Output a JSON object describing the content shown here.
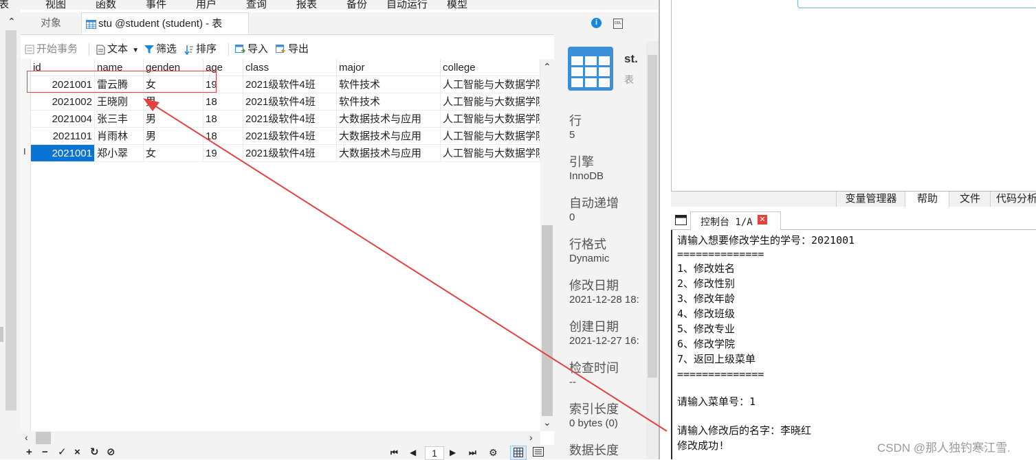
{
  "menu": {
    "items": [
      "表",
      "视图",
      "函数",
      "事件",
      "用户",
      "查询",
      "报表",
      "备份",
      "自动运行",
      "模型"
    ]
  },
  "tabs": {
    "objects": "对象",
    "table": "stu @student (student) - 表"
  },
  "toolbar": {
    "begin_transaction": "开始事务",
    "text": "文本",
    "filter": "筛选",
    "sort": "排序",
    "import": "导入",
    "export": "导出"
  },
  "grid": {
    "columns": [
      "id",
      "name",
      "genden",
      "age",
      "class",
      "major",
      "college"
    ],
    "rows": [
      [
        "2021001",
        "雷云腾",
        "女",
        "19",
        "2021级软件4班",
        "软件技术",
        "人工智能与大数据学院"
      ],
      [
        "2021002",
        "王晓刚",
        "男",
        "18",
        "2021级软件4班",
        "软件技术",
        "人工智能与大数据学院"
      ],
      [
        "2021004",
        "张三丰",
        "男",
        "18",
        "2021级软件4班",
        "大数据技术与应用",
        "人工智能与大数据学院"
      ],
      [
        "2021101",
        "肖雨林",
        "男",
        "18",
        "2021级软件4班",
        "大数据技术与应用",
        "人工智能与大数据学院"
      ],
      [
        "2021001",
        "郑小翠",
        "女",
        "19",
        "2021级软件4班",
        "大数据技术与应用",
        "人工智能与大数据学院"
      ]
    ],
    "row_cursor": "I"
  },
  "status": {
    "page": "1"
  },
  "info": {
    "name": "st.",
    "type": "表",
    "rows_label": "行",
    "rows_value": "5",
    "engine_label": "引擎",
    "engine_value": "InnoDB",
    "autoinc_label": "自动递增",
    "autoinc_value": "0",
    "format_label": "行格式",
    "format_value": "Dynamic",
    "modified_label": "修改日期",
    "modified_value": "2021-12-28 18:",
    "created_label": "创建日期",
    "created_value": "2021-12-27 16:",
    "checked_label": "检查时间",
    "checked_value": "--",
    "index_len_label": "索引长度",
    "index_len_value": "0 bytes (0)",
    "data_len_label": "数据长度"
  },
  "right_tabs": [
    "变量管理器",
    "帮助",
    "文件",
    "代码分析"
  ],
  "console": {
    "tab_label": "控制台 1/A",
    "lines": [
      "请输入想要修改学生的学号：2021001",
      "==============",
      "1、修改姓名",
      "2、修改性别",
      "3、修改年龄",
      "4、修改班级",
      "5、修改专业",
      "6、修改学院",
      "7、返回上级菜单",
      "==============",
      "",
      "请输入菜单号：1",
      "",
      "请输入修改后的名字：李晓红",
      "修改成功!"
    ]
  },
  "watermark": "CSDN @那人独钓寒江雪.",
  "colors": {
    "selection": "#0a74d4",
    "annotation": "#e8403e",
    "table_icon": "#3b8fd9"
  }
}
